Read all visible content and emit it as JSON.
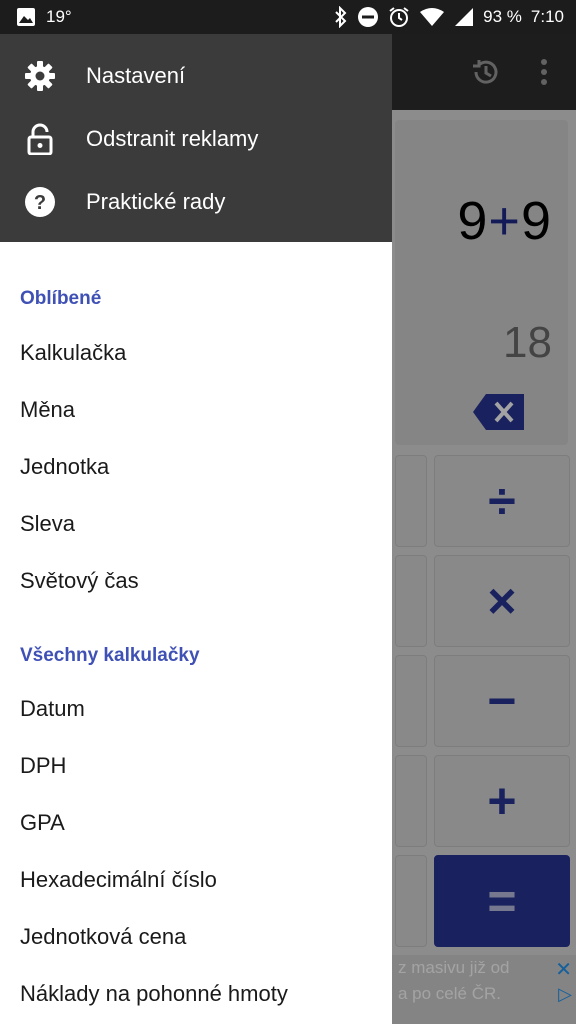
{
  "status_bar": {
    "temperature": "19°",
    "battery": "93 %",
    "time": "7:10"
  },
  "calculator": {
    "expression_left": "9",
    "expression_op": "+",
    "expression_right": "9",
    "result": "18",
    "keys": {
      "divide": "÷",
      "multiply": "×",
      "minus": "−",
      "plus": "+",
      "equals": "="
    },
    "ad_line1": "z masivu již od",
    "ad_line2": "a po celé ČR."
  },
  "drawer": {
    "header_items": [
      {
        "label": "Nastavení",
        "icon": "gear-icon"
      },
      {
        "label": "Odstranit reklamy",
        "icon": "unlock-icon"
      },
      {
        "label": "Praktické rady",
        "icon": "help-icon"
      }
    ],
    "favorites": {
      "title": "Oblíbené",
      "items": [
        "Kalkulačka",
        "Měna",
        "Jednotka",
        "Sleva",
        "Světový čas"
      ]
    },
    "all": {
      "title": "Všechny kalkulačky",
      "items": [
        "Datum",
        "DPH",
        "GPA",
        "Hexadecimální číslo",
        "Jednotková cena",
        "Náklady na pohonné hmoty"
      ]
    }
  },
  "colors": {
    "accent": "#3f51b5",
    "equals_key": "#283593",
    "drawer_header": "#3b3b3b"
  }
}
